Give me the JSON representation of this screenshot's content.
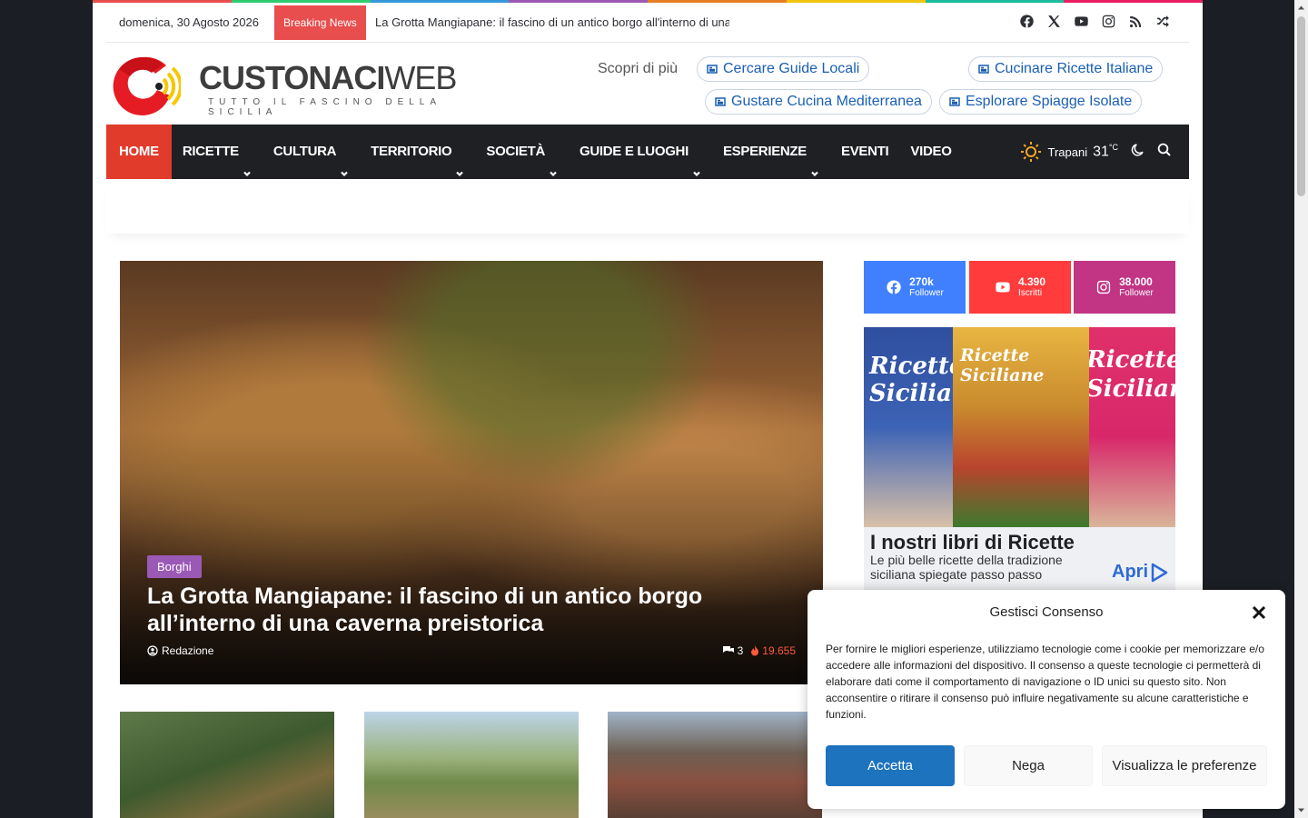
{
  "topbar": {
    "date": "domenica, 30 Agosto 2026",
    "breaking_label": "Breaking News",
    "ticker_text": "La Grotta Mangiapane: il fascino di un antico borgo all'interno di una caverna preistorica",
    "social_icons": [
      "facebook-icon",
      "x-icon",
      "youtube-icon",
      "instagram-icon",
      "rss-icon",
      "random-icon"
    ]
  },
  "header": {
    "logo_bold": "CUSTONACI",
    "logo_thin": "WEB",
    "tagline": "TUTTO IL FASCINO DELLA SICILIA",
    "discover_label": "Scopri di più",
    "chips": [
      "Cercare Guide Locali",
      "Cucinare Ricette Italiane",
      "Gustare Cucina Mediterranea",
      "Esplorare Spiagge Isolate"
    ]
  },
  "nav": {
    "items": [
      {
        "label": "HOME",
        "dropdown": false,
        "active": true
      },
      {
        "label": "RICETTE",
        "dropdown": true
      },
      {
        "label": "CULTURA",
        "dropdown": true
      },
      {
        "label": "TERRITORIO",
        "dropdown": true
      },
      {
        "label": "SOCIETÀ",
        "dropdown": true
      },
      {
        "label": "GUIDE E LUOGHI",
        "dropdown": true
      },
      {
        "label": "ESPERIENZE",
        "dropdown": true
      },
      {
        "label": "EVENTI",
        "dropdown": false
      },
      {
        "label": "VIDEO",
        "dropdown": false
      }
    ],
    "weather_city": "Trapani",
    "weather_temp": "31",
    "weather_unit": "°C"
  },
  "hero": {
    "category": "Borghi",
    "title": "La Grotta Mangiapane: il fascino di un antico borgo all’interno di una caverna preistorica",
    "author": "Redazione",
    "comments": "3",
    "views": "19.655"
  },
  "sidebar": {
    "social": [
      {
        "count": "270k",
        "label": "Follower",
        "icon": "facebook-icon"
      },
      {
        "count": "4.390",
        "label": "Iscritti",
        "icon": "youtube-icon"
      },
      {
        "count": "38.000",
        "label": "Follower",
        "icon": "instagram-icon"
      }
    ],
    "book_ad": {
      "book_left": "Ricette Siciliane",
      "book_middle": "Ricette Siciliane",
      "book_right": "Ricette Siciliane",
      "heading": "I nostri libri di Ricette",
      "subtext": "Le più belle ricette della tradizione siciliana spiegate passo passo",
      "cta": "Apri"
    }
  },
  "consent": {
    "title": "Gestisci Consenso",
    "text": "Per fornire le migliori esperienze, utilizziamo tecnologie come i cookie per memorizzare e/o accedere alle informazioni del dispositivo. Il consenso a queste tecnologie ci permetterà di elaborare dati come il comportamento di navigazione o ID unici su questo sito. Non acconsentire o ritirare il consenso può influire negativamente su alcune caratteristiche e funzioni.",
    "accept": "Accetta",
    "deny": "Nega",
    "preferences": "Visualizza le preferenze"
  },
  "colors": {
    "nav_bg": "#1f2024",
    "nav_active": "#e13b2b",
    "breaking": "#e84e4e",
    "accent_blue": "#1e73be",
    "category_badge": "#9b59b6"
  }
}
